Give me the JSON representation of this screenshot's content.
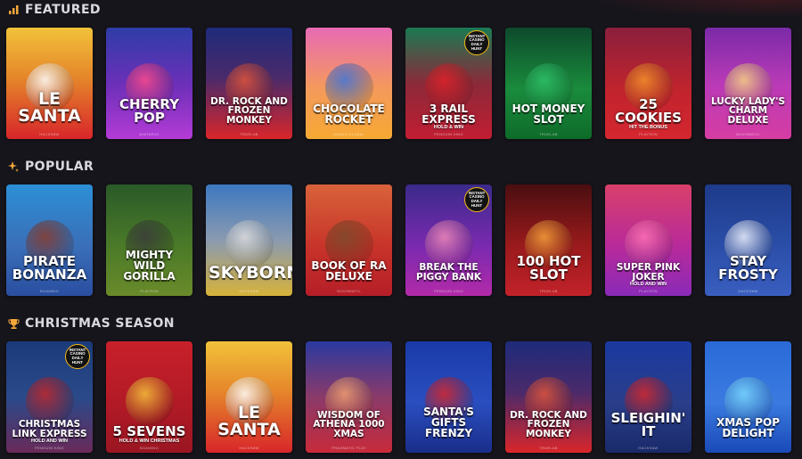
{
  "sections": [
    {
      "title": "FEATURED",
      "icon": "chart-icon",
      "games": [
        {
          "title": "LE SANTA",
          "provider": "HACKSAW",
          "bg": "linear-gradient(180deg,#f2c23a 0%,#e5862a 45%,#d8262a 100%)",
          "art": "#fefefe",
          "size": "t-lg"
        },
        {
          "title": "CHERRY POP",
          "provider": "AVATARUX",
          "bg": "linear-gradient(180deg,#2e3da8 0%,#6b2fb8 50%,#b43bd6 100%)",
          "art": "#ff4a8a",
          "size": "t-md"
        },
        {
          "title": "DR. ROCK AND FROZEN MONKEY",
          "provider": "TRUELAB",
          "bg": "linear-gradient(180deg,#1e2b7a 0%,#4a2a6b 45%,#d9262a 100%)",
          "art": "#e2553a",
          "size": "t-xs"
        },
        {
          "title": "CHOCOLATE ROCKET",
          "provider": "GAMES GLOBAL",
          "bg": "linear-gradient(180deg,#e86ab5 0%,#f49a5b 55%,#f6a933 100%)",
          "art": "#3e74d8",
          "size": "t-sm"
        },
        {
          "title": "3 RAIL EXPRESS",
          "sub": "HOLD & WIN",
          "provider": "PENGUIN KING",
          "bg": "linear-gradient(180deg,#1a7a53 0%,#8b2a3a 50%,#c21d32 100%)",
          "art": "#e0222a",
          "size": "t-sm",
          "badge": "INSTANT CASINO DAILY HUNT"
        },
        {
          "title": "HOT MONEY SLOT",
          "provider": "TRUELAB",
          "bg": "linear-gradient(180deg,#0d4a2c 0%,#1a8b3c 55%,#0e6b2a 100%)",
          "art": "#2ec26a",
          "size": "t-sm"
        },
        {
          "title": "25 COOKIES",
          "sub": "HIT THE BONUS",
          "provider": "PLAYSON",
          "bg": "linear-gradient(180deg,#8a1f3c 0%,#c0242e 55%,#d5262f 100%)",
          "art": "#f4922a",
          "size": "t-md"
        },
        {
          "title": "LUCKY LADY'S CHARM DELUXE",
          "provider": "NOVOMATIC",
          "bg": "linear-gradient(180deg,#7a2aa8 0%,#b93ab7 50%,#d63da3 100%)",
          "art": "#f6d483",
          "size": "t-xs"
        }
      ]
    },
    {
      "title": "POPULAR",
      "icon": "sparkle-icon",
      "games": [
        {
          "title": "PIRATE BONANZA",
          "provider": "BGAMING",
          "bg": "linear-gradient(180deg,#2c8fd6 0%,#3a6fb8 55%,#2a4ea0 100%)",
          "art": "#8a3a2a",
          "size": "t-md"
        },
        {
          "title": "MIGHTY WILD GORILLA",
          "provider": "PLAYSON",
          "bg": "linear-gradient(180deg,#2a5a28 0%,#4a7a28 55%,#6a8a2a 100%)",
          "art": "#3a3a3a",
          "size": "t-sm"
        },
        {
          "title": "SKYBORN",
          "provider": "HACKSAW",
          "bg": "linear-gradient(180deg,#3c78c0 0%,#8a9ab0 50%,#d6b23a 100%)",
          "art": "#dddddd",
          "size": "t-lg"
        },
        {
          "title": "BOOK OF RA DELUXE",
          "provider": "NOVOMATIC",
          "bg": "linear-gradient(180deg,#d8623a 0%,#c8342a 55%,#b61e28 100%)",
          "art": "#7a4a2a",
          "size": "t-sm"
        },
        {
          "title": "BREAK THE PIGGY BANK",
          "provider": "PENGUIN KING",
          "bg": "linear-gradient(180deg,#3a2a8a 0%,#7a2ab0 55%,#b22aa8 100%)",
          "art": "#f08ab8",
          "size": "t-xs",
          "badge": "INSTANT CASINO DAILY HUNT"
        },
        {
          "title": "100 HOT SLOT",
          "provider": "TRUELAB",
          "bg": "linear-gradient(180deg,#4a0e10 0%,#9a1a1c 55%,#c2222a 100%)",
          "art": "#f6a23a",
          "size": "t-md"
        },
        {
          "title": "SUPER PINK JOKER",
          "sub": "HOLD AND WIN",
          "provider": "PLAYSON",
          "bg": "linear-gradient(180deg,#d8406a 0%,#b82a9a 55%,#8a2ab8 100%)",
          "art": "#ff72b6",
          "size": "t-xs"
        },
        {
          "title": "STAY FROSTY",
          "provider": "HACKSAW",
          "bg": "linear-gradient(180deg,#1e3a8a 0%,#2a4ea8 55%,#3a5ec0 100%)",
          "art": "#f0f4ff",
          "size": "t-md"
        }
      ]
    },
    {
      "title": "CHRISTMAS SEASON",
      "icon": "trophy-icon",
      "games": [
        {
          "title": "CHRISTMAS LINK EXPRESS",
          "sub": "HOLD AND WIN",
          "provider": "PENGUIN KING",
          "bg": "linear-gradient(180deg,#1a3a7a 0%,#2a4a8a 50%,#6a2a5a 100%)",
          "art": "#c2262a",
          "size": "t-xs",
          "badge": "INSTANT CASINO DAILY HUNT"
        },
        {
          "title": "5 SEVENS",
          "sub": "HOLD & WIN CHRISTMAS",
          "provider": "BGAMING",
          "bg": "linear-gradient(180deg,#c8202a 0%,#b21a26 55%,#9a1622 100%)",
          "art": "#f6c23a",
          "size": "t-md"
        },
        {
          "title": "LE SANTA",
          "provider": "HACKSAW",
          "bg": "linear-gradient(180deg,#f2c23a 0%,#e5862a 45%,#d8262a 100%)",
          "art": "#fefefe",
          "size": "t-lg"
        },
        {
          "title": "WISDOM OF ATHENA 1000 XMAS",
          "provider": "PRAGMATIC PLAY",
          "bg": "linear-gradient(180deg,#2a3aa0 0%,#8a3a6a 50%,#c82a3a 100%)",
          "art": "#f0a070",
          "size": "t-xs"
        },
        {
          "title": "SANTA'S GIFTS FRENZY",
          "provider": "",
          "bg": "linear-gradient(180deg,#1a3aa8 0%,#2a4ec0 55%,#1a2e8a 100%)",
          "art": "#d8262a",
          "size": "t-sm"
        },
        {
          "title": "DR. ROCK AND FROZEN MONKEY",
          "provider": "TRUELAB",
          "bg": "linear-gradient(180deg,#1e2b7a 0%,#4a2a6b 45%,#d9262a 100%)",
          "art": "#e2553a",
          "size": "t-xs"
        },
        {
          "title": "SLEIGHIN' IT",
          "provider": "HACKSAW",
          "bg": "linear-gradient(180deg,#1a3aa0 0%,#2a3e8a 55%,#1a2a6a 100%)",
          "art": "#d8262a",
          "size": "t-md"
        },
        {
          "title": "XMAS POP DELIGHT",
          "provider": "",
          "bg": "linear-gradient(180deg,#2a6ad8 0%,#3a7ae0 55%,#1a4ab8 100%)",
          "art": "#7ad8ff",
          "size": "t-sm"
        }
      ]
    }
  ]
}
